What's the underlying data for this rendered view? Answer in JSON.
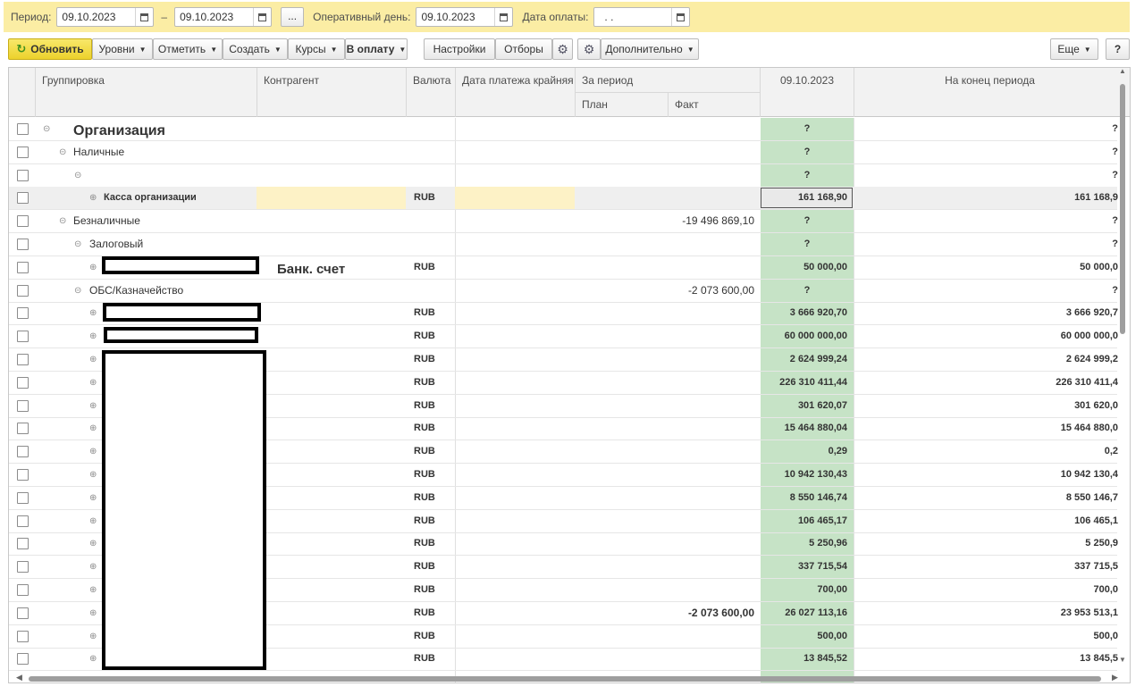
{
  "filters": {
    "period_label": "Период:",
    "date_from": "09.10.2023",
    "dash": "–",
    "date_to": "09.10.2023",
    "ellipsis": "...",
    "op_day_label": "Оперативный день:",
    "op_day": "09.10.2023",
    "pay_date_label": "Дата оплаты:",
    "pay_date": ".  ."
  },
  "toolbar": {
    "refresh": "Обновить",
    "levels": "Уровни",
    "mark": "Отметить",
    "create": "Создать",
    "rates": "Курсы",
    "to_pay": "В оплату",
    "settings": "Настройки",
    "filters": "Отборы",
    "additional": "Дополнительно",
    "more": "Еще",
    "help": "?"
  },
  "columns": {
    "grouping": "Группировка",
    "counterparty": "Контрагент",
    "currency": "Валюта",
    "due_date": "Дата платежа крайняя",
    "for_period": "За период",
    "plan": "План",
    "fact": "Факт",
    "date_col": "09.10.2023",
    "end_period": "На конец периода"
  },
  "rows": [
    {
      "label": "Организация",
      "currency": "",
      "fact": "",
      "day": "?",
      "end": "?"
    },
    {
      "label": "Наличные",
      "currency": "",
      "fact": "",
      "day": "?",
      "end": "?"
    },
    {
      "label": "",
      "currency": "",
      "fact": "",
      "day": "?",
      "end": "?"
    },
    {
      "label": "Касса организации",
      "currency": "RUB",
      "fact": "",
      "day": "161 168,90",
      "end": "161 168,9"
    },
    {
      "label": "Безналичные",
      "currency": "",
      "fact": "-19 496 869,10",
      "day": "?",
      "end": "?"
    },
    {
      "label": "Залоговый",
      "currency": "",
      "fact": "",
      "day": "?",
      "end": "?"
    },
    {
      "label": "",
      "counterparty": "Банк. счет",
      "currency": "RUB",
      "fact": "",
      "day": "50 000,00",
      "end": "50 000,0"
    },
    {
      "label": "ОБС/Казначейство",
      "currency": "",
      "fact": "-2 073 600,00",
      "day": "?",
      "end": "?"
    },
    {
      "label": "",
      "currency": "RUB",
      "fact": "",
      "day": "3 666 920,70",
      "end": "3 666 920,7"
    },
    {
      "label": "",
      "currency": "RUB",
      "fact": "",
      "day": "60 000 000,00",
      "end": "60 000 000,0"
    },
    {
      "label": "",
      "currency": "RUB",
      "fact": "",
      "day": "2 624 999,24",
      "end": "2 624 999,2"
    },
    {
      "label": "",
      "currency": "RUB",
      "fact": "",
      "day": "226 310 411,44",
      "end": "226 310 411,4"
    },
    {
      "label": "",
      "currency": "RUB",
      "fact": "",
      "day": "301 620,07",
      "end": "301 620,0"
    },
    {
      "label": "",
      "currency": "RUB",
      "fact": "",
      "day": "15 464 880,04",
      "end": "15 464 880,0"
    },
    {
      "label": "",
      "currency": "RUB",
      "fact": "",
      "day": "0,29",
      "end": "0,2"
    },
    {
      "label": "",
      "currency": "RUB",
      "fact": "",
      "day": "10 942 130,43",
      "end": "10 942 130,4"
    },
    {
      "label": "",
      "currency": "RUB",
      "fact": "",
      "day": "8 550 146,74",
      "end": "8 550 146,7"
    },
    {
      "label": "",
      "currency": "RUB",
      "fact": "",
      "day": "106 465,17",
      "end": "106 465,1"
    },
    {
      "label": "",
      "currency": "RUB",
      "fact": "",
      "day": "5 250,96",
      "end": "5 250,9"
    },
    {
      "label": "",
      "currency": "RUB",
      "fact": "",
      "day": "337 715,54",
      "end": "337 715,5"
    },
    {
      "label": "",
      "currency": "RUB",
      "fact": "",
      "day": "700,00",
      "end": "700,0"
    },
    {
      "label": "",
      "currency": "RUB",
      "fact": "-2 073 600,00",
      "day": "26 027 113,16",
      "end": "23 953 513,1"
    },
    {
      "label": "",
      "currency": "RUB",
      "fact": "",
      "day": "500,00",
      "end": "500,0"
    },
    {
      "label": "",
      "currency": "RUB",
      "fact": "",
      "day": "13 845,52",
      "end": "13 845,5"
    }
  ]
}
